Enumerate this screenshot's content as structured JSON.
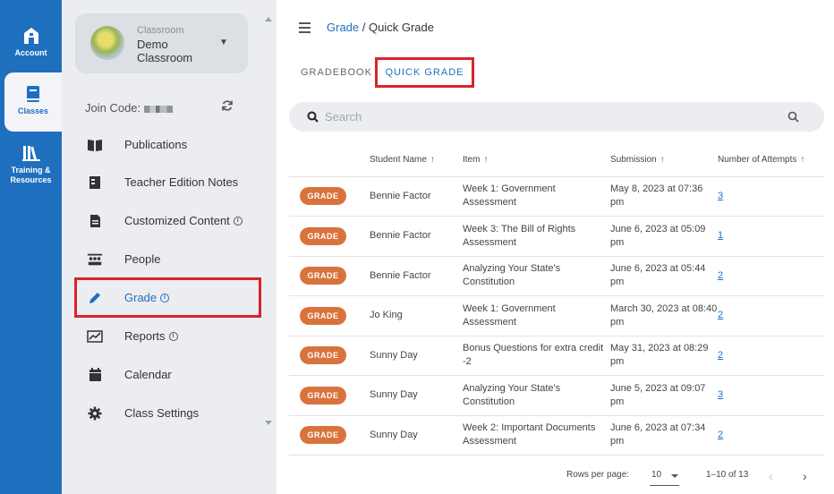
{
  "rail": {
    "account": "Account",
    "classes": "Classes",
    "training": "Training &",
    "training2": "Resources"
  },
  "class_card": {
    "label": "Classroom",
    "name": "Demo Classroom"
  },
  "join_code_label": "Join Code:",
  "nav": [
    {
      "label": "Publications"
    },
    {
      "label": "Teacher Edition Notes"
    },
    {
      "label": "Customized Content"
    },
    {
      "label": "People"
    },
    {
      "label": "Grade"
    },
    {
      "label": "Reports"
    },
    {
      "label": "Calendar"
    },
    {
      "label": "Class Settings"
    }
  ],
  "breadcrumb": {
    "parent": "Grade",
    "separator": "/",
    "current": "Quick Grade"
  },
  "tabs": {
    "gradebook": "GRADEBOOK",
    "quick_grade": "QUICK GRADE"
  },
  "search": {
    "placeholder": "Search"
  },
  "table": {
    "headers": [
      "Student Name",
      "Item",
      "Submission",
      "Number of Attempts"
    ],
    "grade_label": "GRADE",
    "rows": [
      {
        "student": "Bennie Factor",
        "item": "Week 1: Government Assessment",
        "submission": "May 8, 2023 at 07:36 pm",
        "attempts": "3"
      },
      {
        "student": "Bennie Factor",
        "item": "Week 3: The Bill of Rights Assessment",
        "submission": "June 6, 2023 at 05:09 pm",
        "attempts": "1"
      },
      {
        "student": "Bennie Factor",
        "item": "Analyzing Your State's Constitution",
        "submission": "June 6, 2023 at 05:44 pm",
        "attempts": "2"
      },
      {
        "student": "Jo King",
        "item": "Week 1: Government Assessment",
        "submission": "March 30, 2023 at 08:40 pm",
        "attempts": "2"
      },
      {
        "student": "Sunny Day",
        "item": "Bonus Questions for extra credit -2",
        "submission": "May 31, 2023 at 08:29 pm",
        "attempts": "2"
      },
      {
        "student": "Sunny Day",
        "item": "Analyzing Your State's Constitution",
        "submission": "June 5, 2023 at 09:07 pm",
        "attempts": "3"
      },
      {
        "student": "Sunny Day",
        "item": "Week 2: Important Documents Assessment",
        "submission": "June 6, 2023 at 07:34 pm",
        "attempts": "2"
      }
    ]
  },
  "pager": {
    "rows_label": "Rows per page:",
    "rows_value": "10",
    "range": "1–10 of 13"
  },
  "colors": {
    "brand": "#1f6fbf",
    "grade_button": "#d9733d",
    "highlight": "#d9232d"
  }
}
